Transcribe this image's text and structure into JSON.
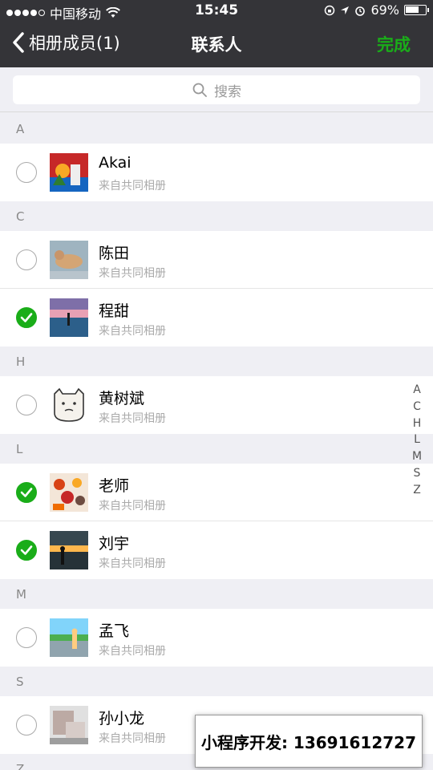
{
  "status_bar": {
    "carrier": "中国移动",
    "time": "15:45",
    "battery_percent": "69%",
    "battery_level": 0.69,
    "signal_bars": 4
  },
  "nav": {
    "back_label": "相册成员(1)",
    "title": "联系人",
    "done_label": "完成"
  },
  "search": {
    "placeholder": "搜索"
  },
  "sections": [
    {
      "letter": "A",
      "contacts": [
        {
          "name": "Akai",
          "subtitle": "来自共同相册",
          "checked": false
        }
      ]
    },
    {
      "letter": "C",
      "contacts": [
        {
          "name": "陈田",
          "subtitle": "来自共同相册",
          "checked": false
        },
        {
          "name": "程甜",
          "subtitle": "来自共同相册",
          "checked": true
        }
      ]
    },
    {
      "letter": "H",
      "contacts": [
        {
          "name": "黄树斌",
          "subtitle": "来自共同相册",
          "checked": false
        }
      ]
    },
    {
      "letter": "L",
      "contacts": [
        {
          "name": "老师",
          "subtitle": "来自共同相册",
          "checked": true
        },
        {
          "name": "刘宇",
          "subtitle": "来自共同相册",
          "checked": true
        }
      ]
    },
    {
      "letter": "M",
      "contacts": [
        {
          "name": "孟飞",
          "subtitle": "来自共同相册",
          "checked": false
        }
      ]
    },
    {
      "letter": "S",
      "contacts": [
        {
          "name": "孙小龙",
          "subtitle": "来自共同相册",
          "checked": false
        }
      ]
    },
    {
      "letter": "Z",
      "contacts": []
    }
  ],
  "index_letters": [
    "A",
    "C",
    "H",
    "L",
    "M",
    "S",
    "Z"
  ],
  "banner": {
    "text": "小程序开发: 13691612727"
  },
  "colors": {
    "accent": "#1aad19",
    "navbar": "#343438",
    "background": "#efeff4"
  }
}
